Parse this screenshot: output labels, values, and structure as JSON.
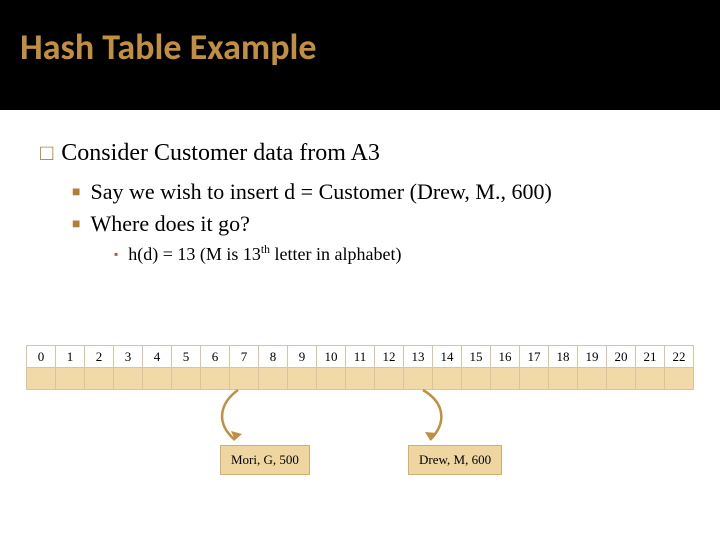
{
  "title": "Hash Table Example",
  "bullets": {
    "l1": "Consider Customer data from A3",
    "l2a": "Say we wish to insert d = Customer (Drew, M., 600)",
    "l2b": "Where does it go?",
    "l3_pre": "h(d) = 13   (M is 13",
    "l3_sup": "th",
    "l3_post": " letter in alphabet)"
  },
  "indices": [
    "0",
    "1",
    "2",
    "3",
    "4",
    "5",
    "6",
    "7",
    "8",
    "9",
    "10",
    "11",
    "12",
    "13",
    "14",
    "15",
    "16",
    "17",
    "18",
    "19",
    "20",
    "21",
    "22"
  ],
  "box1": "Mori, G, 500",
  "box2": "Drew, M, 600",
  "chart_data": {
    "type": "table",
    "description": "Hash table with 23 slots (indices 0–22). Second row (data row) is empty. Arrows point from labeled boxes to slots.",
    "pointers": [
      {
        "label": "Mori, G, 500",
        "target_index": 7
      },
      {
        "label": "Drew, M, 600",
        "target_index": 13
      }
    ]
  }
}
